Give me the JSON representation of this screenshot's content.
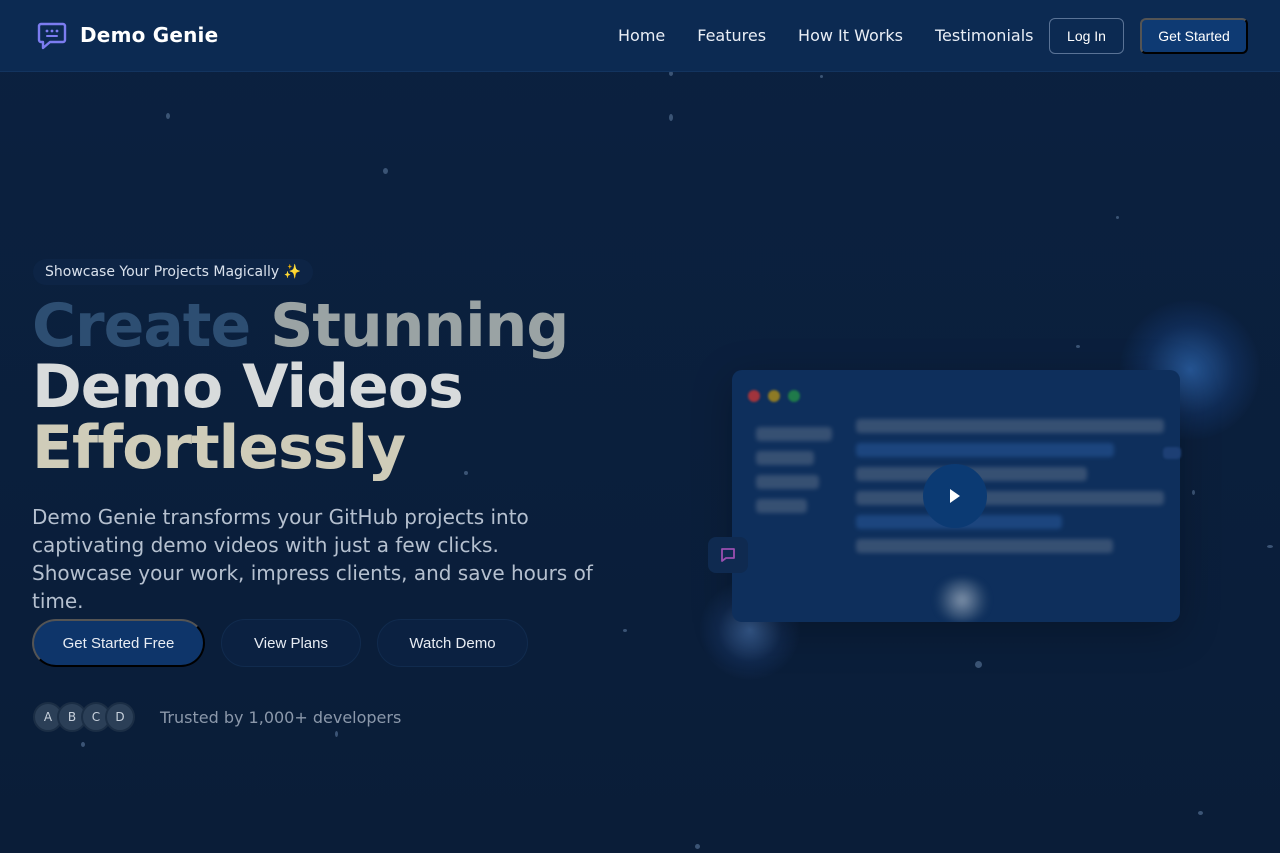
{
  "nav": {
    "brand": "Demo Genie",
    "links": [
      "Home",
      "Features",
      "How It Works",
      "Testimonials"
    ],
    "login": "Log In",
    "get_started": "Get Started"
  },
  "hero": {
    "badge": "Showcase Your Projects Magically ✨",
    "headline": {
      "create": "Create",
      "stunning": "Stunning",
      "line2": "Demo Videos",
      "line3": "Effortlessly"
    },
    "lead": "Demo Genie transforms your GitHub projects into captivating demo videos with just a few clicks. Showcase your work, impress clients, and save hours of time.",
    "cta_primary": "Get Started Free",
    "cta_plans": "View Plans",
    "cta_watch": "Watch Demo",
    "avatars": [
      "A",
      "B",
      "C",
      "D"
    ],
    "trust": "Trusted by 1,000+ developers"
  },
  "colors": {
    "background": "#0a1e3a",
    "nav": "#0c2a52",
    "primary_button": "#0e356a",
    "brand_icon": "#7c7cf0",
    "window_red": "#a1343c",
    "window_yellow": "#8e7a25",
    "window_green": "#1f7a4a"
  },
  "icons": {
    "brand": "chat-bubble-icon",
    "play": "play-icon",
    "chat": "message-icon"
  }
}
